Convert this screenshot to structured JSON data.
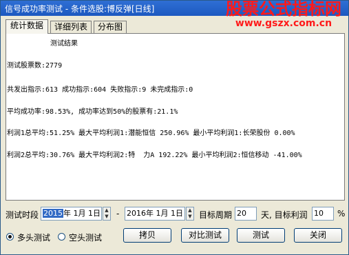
{
  "window": {
    "title": "信号成功率测试 - 条件选股:博反弹[日线]"
  },
  "watermark": {
    "main": "股票公式指标网",
    "url": "www.gszx.com.cn"
  },
  "tabs": [
    "统计数据",
    "详细列表",
    "分布图"
  ],
  "results": {
    "heading": "测试结果",
    "lines": [
      "测试股票数:2779",
      "共发出指示:613 成功指示:604 失败指示:9 未完成指示:0",
      "平均成功率:98.53%, 成功率达到50%的股票有:21.1%",
      "利润1总平均:51.25% 最大平均利润1:潜能恒信 250.96% 最小平均利润1:长荣股份 0.00%",
      "利润2总平均:30.76% 最大平均利润2:特  力A 192.22% 最小平均利润2:恒信移动 -41.00%"
    ]
  },
  "controls": {
    "period_label": "测试时段",
    "start_date_selected": "2015",
    "start_date_rest": "年  1月  1日",
    "dash": "-",
    "end_date": "2016年  1月  1日",
    "target_period_label": "目标周期",
    "target_period_value": "20",
    "target_profit_label": "天, 目标利润",
    "target_profit_value": "10",
    "percent": "%",
    "radio_long": "多头测试",
    "radio_short": "空头测试",
    "btn_copy": "拷贝",
    "btn_compare": "对比测试",
    "btn_test": "测试",
    "btn_close": "关闭"
  }
}
